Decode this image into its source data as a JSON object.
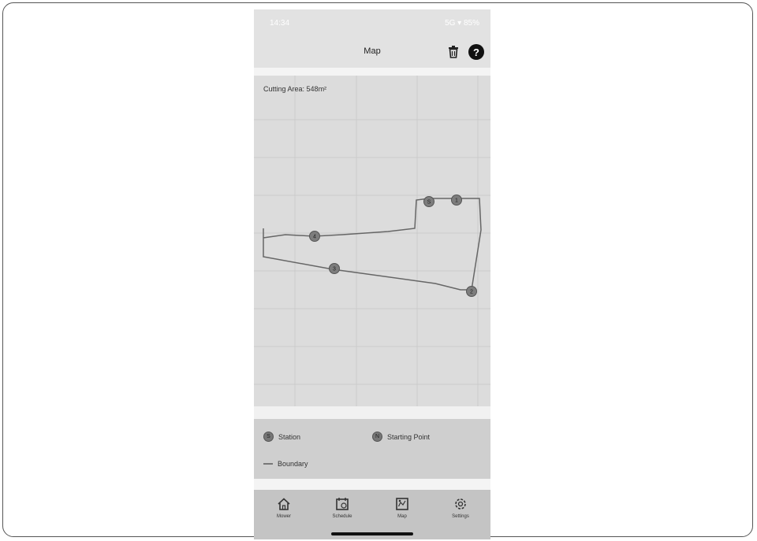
{
  "status_bar": {
    "time": "14:34",
    "indicators": "5G ▾ 85%"
  },
  "header": {
    "title": "Map"
  },
  "map": {
    "cutting_area_label": "Cutting Area:",
    "cutting_area_value": "548m²",
    "markers": [
      {
        "id": "station",
        "label": "S"
      },
      {
        "id": "p1",
        "label": "1"
      },
      {
        "id": "p2",
        "label": "2"
      },
      {
        "id": "p3",
        "label": "3"
      },
      {
        "id": "p4",
        "label": "4"
      }
    ],
    "boundary_color": "#666666"
  },
  "legend": {
    "station_label": "Station",
    "station_glyph": "S",
    "starting_point_label": "Starting Point",
    "starting_point_glyph": "N",
    "boundary_label": "Boundary"
  },
  "tabs": [
    {
      "label": "Mower",
      "icon": "home-icon"
    },
    {
      "label": "Schedule",
      "icon": "calendar-icon"
    },
    {
      "label": "Map",
      "icon": "map-icon"
    },
    {
      "label": "Settings",
      "icon": "gear-icon"
    }
  ]
}
